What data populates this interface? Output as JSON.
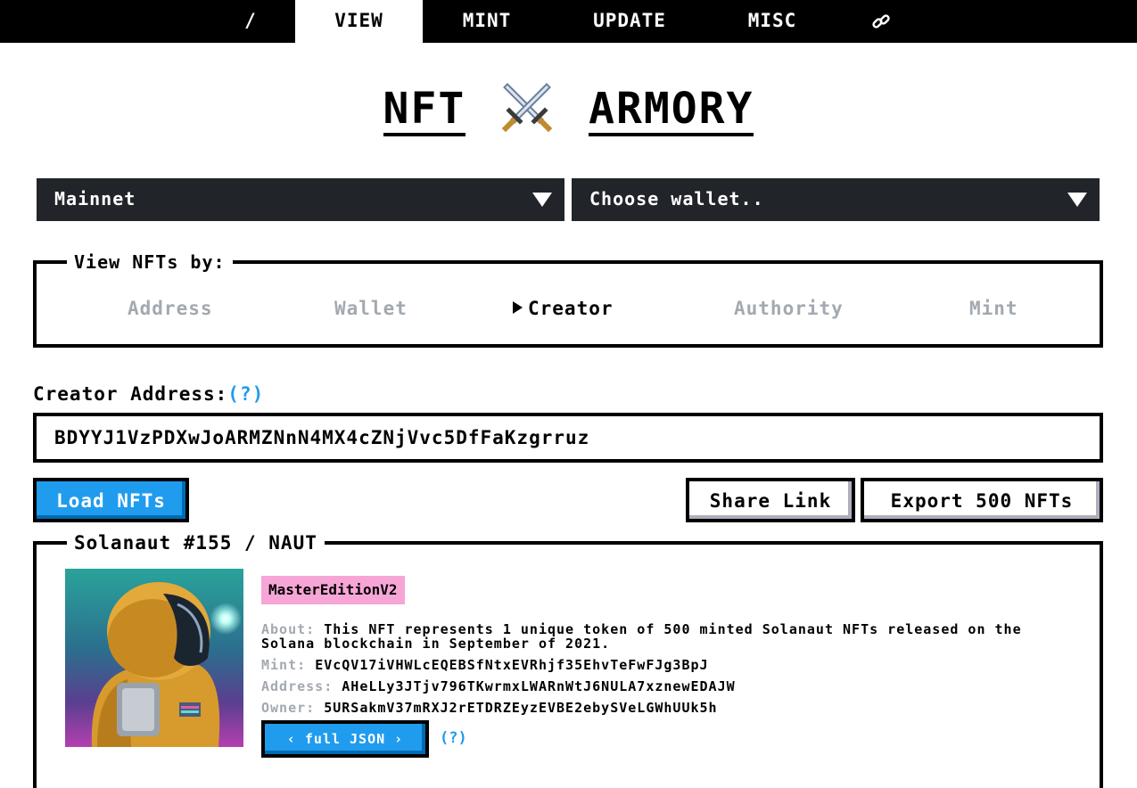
{
  "nav": {
    "items": [
      {
        "label": "/"
      },
      {
        "label": "VIEW"
      },
      {
        "label": "MINT"
      },
      {
        "label": "UPDATE"
      },
      {
        "label": "MISC"
      }
    ],
    "link_icon": "link-icon",
    "active": "VIEW"
  },
  "title": {
    "left": "NFT",
    "right": "ARMORY",
    "emblem": "crossed-swords-icon"
  },
  "network_select": {
    "value": "Mainnet"
  },
  "wallet_select": {
    "value": "Choose wallet.."
  },
  "view_by": {
    "legend": "View NFTs by:",
    "options": [
      "Address",
      "Wallet",
      "Creator",
      "Authority",
      "Mint"
    ],
    "selected": "Creator"
  },
  "creator": {
    "label": "Creator Address:",
    "help": "(?)",
    "value": "BDYYJ1VzPDXwJoARMZNnN4MX4cZNjVvc5DfFaKzgrruz"
  },
  "buttons": {
    "load": "Load NFTs",
    "share": "Share Link",
    "export": "Export 500 NFTs"
  },
  "nft": {
    "legend": "Solanaut #155 / NAUT",
    "badge": "MasterEditionV2",
    "about_key": "About:",
    "about": "This NFT represents 1 unique token of 500 minted Solanaut NFTs released on the Solana blockchain in September of 2021.",
    "mint_key": "Mint:",
    "mint": "EVcQV17iVHWLcEQEBSfNtxEVRhjf35EhvTeFwFJg3BpJ",
    "address_key": "Address:",
    "address": "AHeLLy3JTjv796TKwrmxLWARnWtJ6NULA7xznewEDAJW",
    "owner_key": "Owner:",
    "owner": "5URSakmV37mRXJ2rETDRZEyzEVBE2ebySVeLGWhUUk5h",
    "json_button": "‹ full JSON ›",
    "json_help": "(?)"
  },
  "colors": {
    "primary": "#209cee",
    "dark": "#212529",
    "muted": "#a3a9b0",
    "badge": "#f7a5d6"
  }
}
